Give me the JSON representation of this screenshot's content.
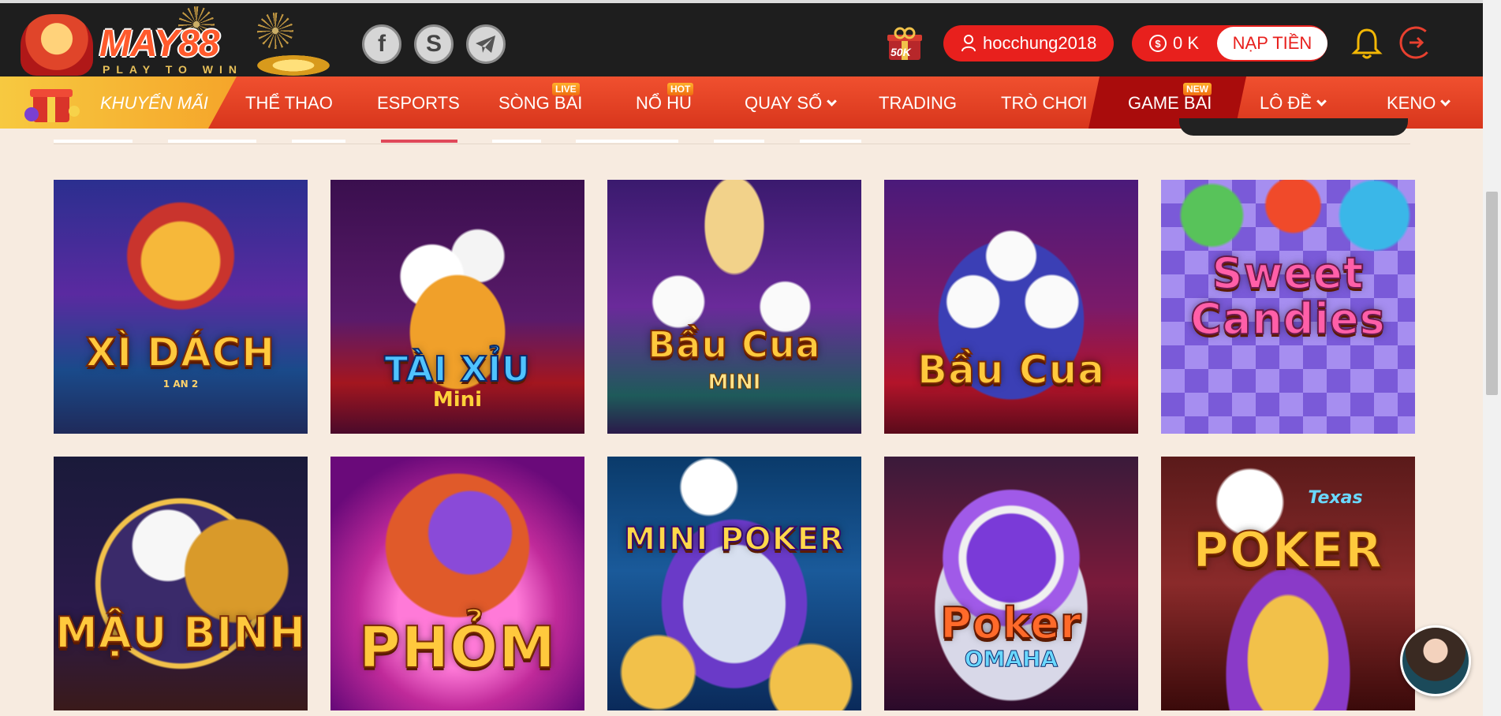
{
  "brand": {
    "name": "MAY88",
    "tagline": "PLAY TO WIN"
  },
  "header": {
    "social_icons": [
      "facebook-icon",
      "skype-icon",
      "telegram-icon"
    ],
    "gift_badge": "50K",
    "username": "hocchung2018",
    "balance": "0 K",
    "deposit_label": "NẠP TIỀN"
  },
  "nav": {
    "promo": "KHUYẾN MÃI",
    "items": [
      {
        "label": "THỂ THAO",
        "badge": ""
      },
      {
        "label": "ESPORTS",
        "badge": ""
      },
      {
        "label": "SÒNG BÀI",
        "badge": "LIVE"
      },
      {
        "label": "NỔ HŨ",
        "badge": "HOT"
      },
      {
        "label": "QUAY SỐ",
        "badge": "",
        "dropdown": true
      },
      {
        "label": "TRADING",
        "badge": ""
      },
      {
        "label": "TRÒ CHƠI",
        "badge": ""
      },
      {
        "label": "GAME BÀI",
        "badge": "NEW",
        "active": true
      },
      {
        "label": "LÔ ĐỀ",
        "badge": "",
        "dropdown": true
      },
      {
        "label": "KENO",
        "badge": "",
        "dropdown": true
      }
    ]
  },
  "games": [
    {
      "title": "XÌ DÁCH",
      "sub": "1 AN 2"
    },
    {
      "title": "TÀI XỈU",
      "sub": "Mini"
    },
    {
      "title": "Bầu Cua",
      "sub": "MINI"
    },
    {
      "title": "Bầu Cua",
      "sub": ""
    },
    {
      "title": "Sweet Candies",
      "sub": ""
    },
    {
      "title": "MẬU BINH",
      "sub": ""
    },
    {
      "title": "PHỎM",
      "sub": ""
    },
    {
      "title": "MINI POKER",
      "sub": ""
    },
    {
      "title": "Poker",
      "sub": "OMAHA"
    },
    {
      "title": "POKER",
      "sub": "Texas"
    }
  ],
  "colors": {
    "topbar": "#1e1e1e",
    "nav": "#e2401f",
    "accent": "#e8201d",
    "page_bg": "#f7ebe0"
  }
}
